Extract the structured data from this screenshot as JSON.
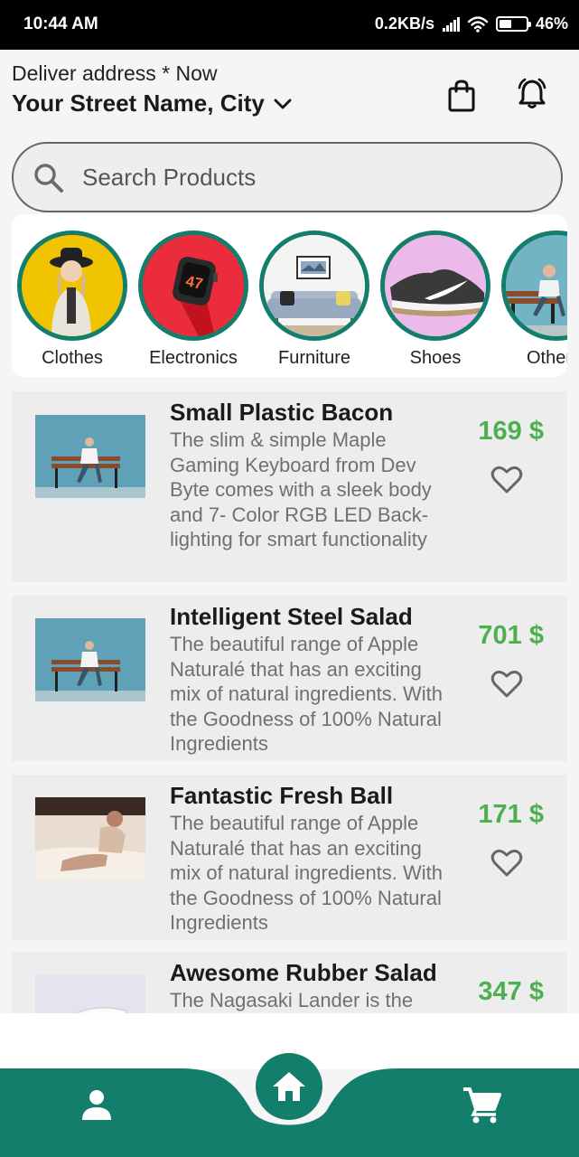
{
  "status_bar": {
    "time": "10:44 AM",
    "network_speed": "0.2KB/s",
    "battery": "46%"
  },
  "header": {
    "deliver_label": "Deliver address * Now",
    "address": "Your Street Name, City",
    "icons": [
      "shopping-bag-icon",
      "bell-icon"
    ]
  },
  "search": {
    "placeholder": "Search Products"
  },
  "categories": [
    {
      "label": "Clothes"
    },
    {
      "label": "Electronics"
    },
    {
      "label": "Furniture"
    },
    {
      "label": "Shoes"
    },
    {
      "label": "Other"
    }
  ],
  "products": [
    {
      "title": "Small Plastic Bacon",
      "description": "The slim & simple Maple Gaming Keyboard from Dev Byte comes with a sleek body and 7- Color RGB LED Back-lighting for smart functionality",
      "price": "169 $"
    },
    {
      "title": "Intelligent Steel Salad",
      "description": "The beautiful range of Apple Naturalé that has an exciting mix of natural ingredients. With the Goodness of 100% Natural Ingredients",
      "price": "701 $"
    },
    {
      "title": "Fantastic Fresh Ball",
      "description": "The beautiful range of Apple Naturalé that has an exciting mix of natural ingredients. With the Goodness of 100% Natural Ingredients",
      "price": "171 $"
    },
    {
      "title": "Awesome Rubber Salad",
      "description": "The Nagasaki Lander is the",
      "price": "347 $"
    }
  ],
  "bottom_nav": {
    "icons": [
      "profile-icon",
      "home-icon",
      "cart-icon"
    ]
  },
  "colors": {
    "accent": "#127e6b",
    "price": "#4caf50",
    "card_bg": "#ededed"
  }
}
